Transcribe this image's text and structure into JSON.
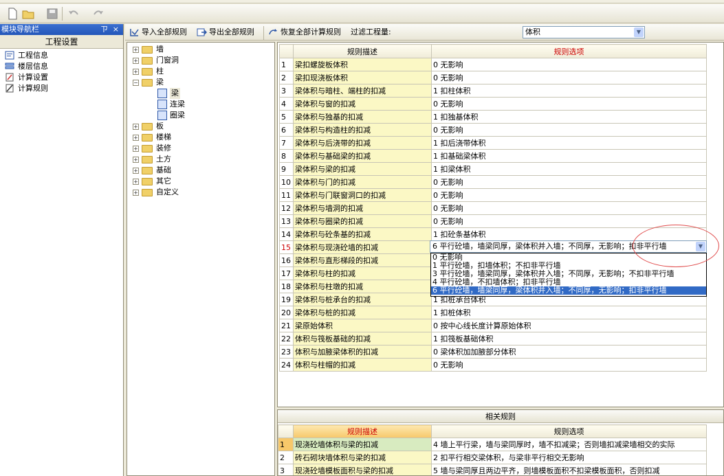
{
  "nav": {
    "title": "模块导航栏",
    "pin": "ㄗ",
    "close": "×",
    "section": "工程设置",
    "items": [
      {
        "label": "工程信息",
        "icon": "project-info-icon"
      },
      {
        "label": "楼层信息",
        "icon": "floor-info-icon"
      },
      {
        "label": "计算设置",
        "icon": "calc-settings-icon"
      },
      {
        "label": "计算规则",
        "icon": "calc-rules-icon"
      }
    ]
  },
  "toolbar2": {
    "import_label": "导入全部规则",
    "export_label": "导出全部规则",
    "restore_label": "恢复全部计算规则",
    "filter_label": "过滤工程量:",
    "filter_value": "体积"
  },
  "tree": {
    "items": [
      {
        "label": "墙",
        "type": "folder",
        "expanded": false
      },
      {
        "label": "门窗洞",
        "type": "folder",
        "expanded": false
      },
      {
        "label": "柱",
        "type": "folder",
        "expanded": false
      },
      {
        "label": "梁",
        "type": "folder",
        "expanded": true
      },
      {
        "label": "梁",
        "type": "leaf",
        "selected": true
      },
      {
        "label": "连梁",
        "type": "leaf"
      },
      {
        "label": "圈梁",
        "type": "leaf"
      },
      {
        "label": "板",
        "type": "folder",
        "expanded": false
      },
      {
        "label": "楼梯",
        "type": "folder",
        "expanded": false
      },
      {
        "label": "装修",
        "type": "folder",
        "expanded": false
      },
      {
        "label": "土方",
        "type": "folder",
        "expanded": false
      },
      {
        "label": "基础",
        "type": "folder",
        "expanded": false
      },
      {
        "label": "其它",
        "type": "folder",
        "expanded": false
      },
      {
        "label": "自定义",
        "type": "folder",
        "expanded": false
      }
    ]
  },
  "rules": {
    "header_desc": "规则描述",
    "header_opt": "规则选项",
    "rows": [
      {
        "n": "1",
        "desc": "梁扣螺旋板体积",
        "opt": "0  无影响"
      },
      {
        "n": "2",
        "desc": "梁扣现浇板体积",
        "opt": "0  无影响"
      },
      {
        "n": "3",
        "desc": "梁体积与暗柱、端柱的扣减",
        "opt": "1 扣柱体积"
      },
      {
        "n": "4",
        "desc": "梁体积与窗的扣减",
        "opt": "0  无影响"
      },
      {
        "n": "5",
        "desc": "梁体积与独基的扣减",
        "opt": "1 扣独基体积"
      },
      {
        "n": "6",
        "desc": "梁体积与构造柱的扣减",
        "opt": "0  无影响"
      },
      {
        "n": "7",
        "desc": "梁体积与后浇带的扣减",
        "opt": "1 扣后浇带体积"
      },
      {
        "n": "8",
        "desc": "梁体积与基础梁的扣减",
        "opt": "1 扣基础梁体积"
      },
      {
        "n": "9",
        "desc": "梁体积与梁的扣减",
        "opt": "1 扣梁体积"
      },
      {
        "n": "10",
        "desc": "梁体积与门的扣减",
        "opt": "0  无影响"
      },
      {
        "n": "11",
        "desc": "梁体积与门联窗洞口的扣减",
        "opt": "0  无影响"
      },
      {
        "n": "12",
        "desc": "梁体积与墙洞的扣减",
        "opt": "0  无影响"
      },
      {
        "n": "13",
        "desc": "梁体积与圈梁的扣减",
        "opt": "0  无影响"
      },
      {
        "n": "14",
        "desc": "梁体积与砼条基的扣减",
        "opt": "1 扣砼条基体积"
      },
      {
        "n": "15",
        "desc": "梁体积与现浇砼墙的扣减",
        "opt": "",
        "selected": true
      },
      {
        "n": "16",
        "desc": "梁体积与直形梯段的扣减",
        "opt": ""
      },
      {
        "n": "17",
        "desc": "梁体积与柱的扣减",
        "opt": ""
      },
      {
        "n": "18",
        "desc": "梁体积与柱墩的扣减",
        "opt": ""
      },
      {
        "n": "19",
        "desc": "梁体积与桩承台的扣减",
        "opt": "1 扣桩承台体积"
      },
      {
        "n": "20",
        "desc": "梁体积与桩的扣减",
        "opt": "1 扣桩体积"
      },
      {
        "n": "21",
        "desc": "梁原始体积",
        "opt": "0 按中心线长度计算原始体积"
      },
      {
        "n": "22",
        "desc": "体积与筏板基础的扣减",
        "opt": "1 扣筏板基础体积"
      },
      {
        "n": "23",
        "desc": "体积与加腋梁体积的扣减",
        "opt": "0 梁体积加加腋部分体积"
      },
      {
        "n": "24",
        "desc": "体积与柱帽的扣减",
        "opt": "0  无影响"
      }
    ]
  },
  "dropdown": {
    "value": "6 平行砼墙，墙梁同厚，梁体积并入墙；不同厚，无影响；扣非平行墙",
    "options": [
      {
        "label": "0  无影响"
      },
      {
        "label": "1 平行砼墙，扣墙体积；不扣非平行墙"
      },
      {
        "label": "3 平行砼墙，墙梁同厚，梁体积并入墙；不同厚，无影响；不扣非平行墙"
      },
      {
        "label": "4 平行砼墙，不扣墙体积；扣非平行墙"
      },
      {
        "label": "6 平行砼墙，墙梁同厚，梁体积并入墙；不同厚，无影响；扣非平行墙",
        "selected": true
      }
    ]
  },
  "related": {
    "title": "相关规则",
    "header_desc": "规则描述",
    "header_opt": "规则选项",
    "rows": [
      {
        "n": "1",
        "desc": "现浇砼墙体积与梁的扣减",
        "opt": "4  墙上平行梁，墙与梁同厚时，墙不扣减梁；否则墙扣减梁墙相交的实际"
      },
      {
        "n": "2",
        "desc": "砖石砌块墙体积与梁的扣减",
        "opt": "2  扣平行相交梁体积，与梁非平行相交无影响"
      },
      {
        "n": "3",
        "desc": "现浇砼墙模板面积与梁的扣减",
        "opt": "5  墙与梁同厚且两边平齐，则墙模板面积不扣梁模板面积，否则扣减"
      }
    ]
  },
  "colors": {
    "accent": "#316ac5",
    "desc_bg": "#fbf8c5",
    "header_opt_bg": "#f7c86a",
    "highlight_circle": "#e04a4a"
  }
}
